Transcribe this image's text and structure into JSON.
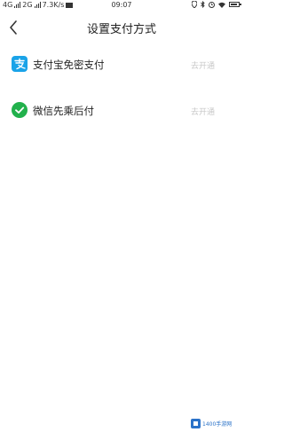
{
  "status_bar": {
    "network": "4G",
    "network2": "2G",
    "speed": "7.3K/s",
    "time": "09:07"
  },
  "nav": {
    "title": "设置支付方式"
  },
  "payment_methods": [
    {
      "label": "支付宝免密支付",
      "action": "去开通",
      "icon": "alipay-icon",
      "color": "#1aa3e8"
    },
    {
      "label": "微信先乘后付",
      "action": "去开通",
      "icon": "wechat-pay-icon",
      "color": "#22b14c"
    }
  ],
  "watermark": {
    "text": "1400手游网"
  },
  "colors": {
    "alipay": "#1aa3e8",
    "wechat": "#22b14c",
    "action_text": "#c8c8c8"
  }
}
